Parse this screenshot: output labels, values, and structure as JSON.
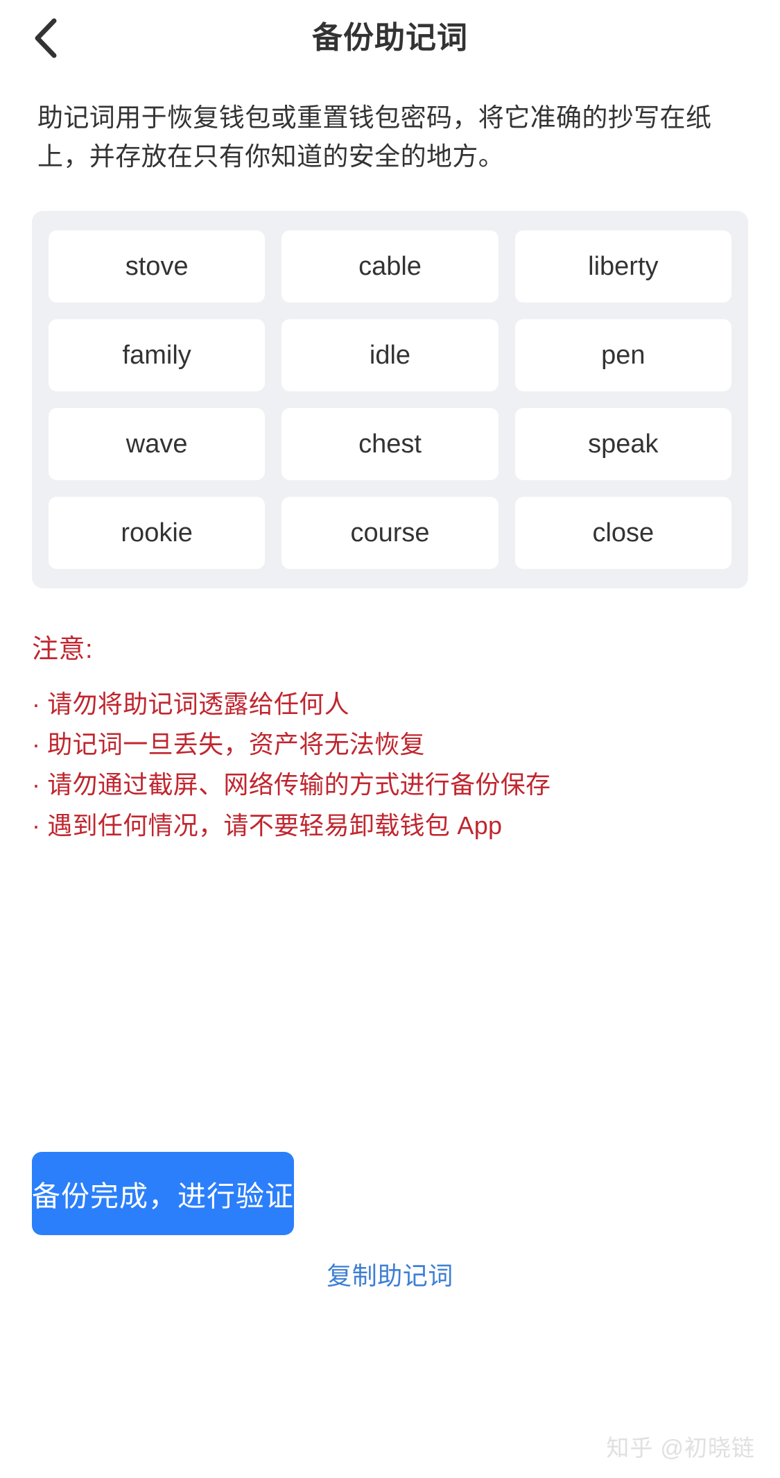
{
  "navbar": {
    "back_icon": "chevron-left-icon",
    "title": "备份助记词"
  },
  "description": "助记词用于恢复钱包或重置钱包密码，将它准确的抄写在纸上，并存放在只有你知道的安全的地方。",
  "mnemonic": {
    "words": [
      "stove",
      "cable",
      "liberty",
      "family",
      "idle",
      "pen",
      "wave",
      "chest",
      "speak",
      "rookie",
      "course",
      "close"
    ]
  },
  "warning": {
    "title": "注意:",
    "bullet_char": "·",
    "items": [
      "请勿将助记词透露给任何人",
      "助记词一旦丢失，资产将无法恢复",
      "请勿通过截屏、网络传输的方式进行备份保存",
      "遇到任何情况，请不要轻易卸载钱包 App"
    ]
  },
  "actions": {
    "primary_label": "备份完成，进行验证",
    "secondary_label": "复制助记词"
  },
  "watermark": "知乎 @初晓链",
  "colors": {
    "primary": "#2b7ffb",
    "link": "#3d7fd4",
    "warning": "#c0262f",
    "grid_bg": "#eff0f4",
    "card_bg": "#ffffff",
    "text": "#333333",
    "watermark": "#e0e0e0"
  }
}
